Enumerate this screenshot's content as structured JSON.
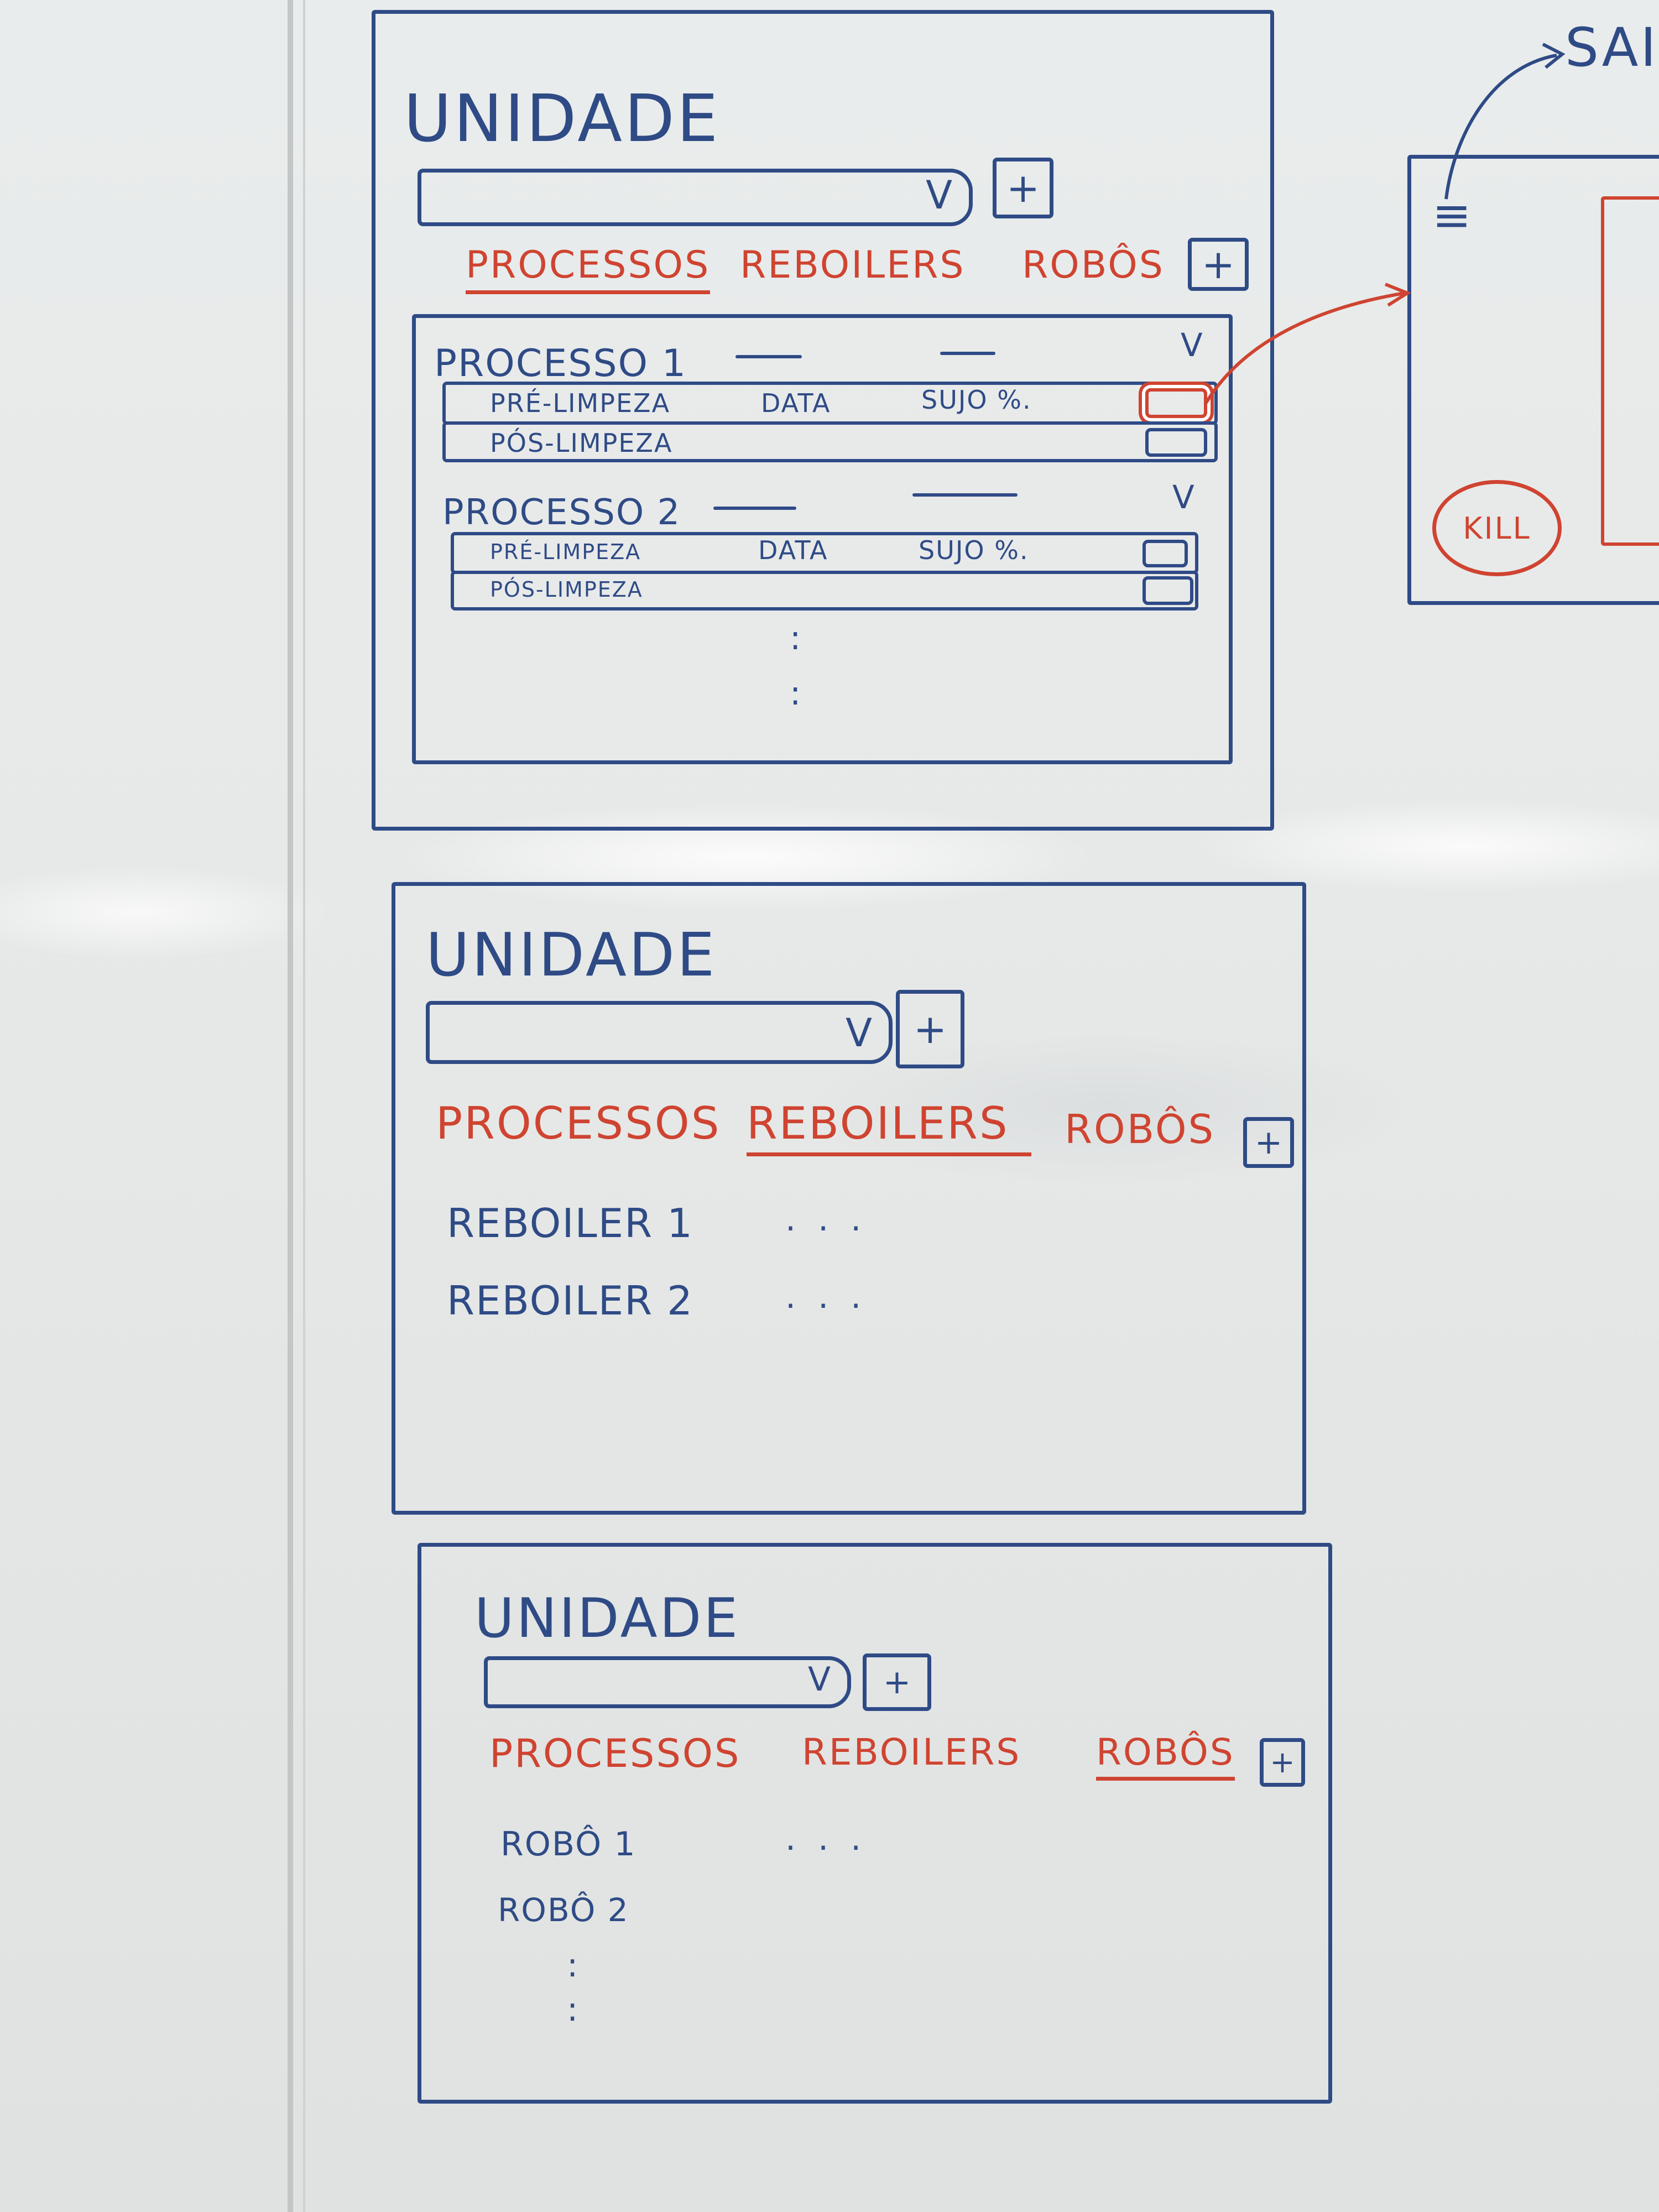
{
  "screen1": {
    "title": "UNIDADE",
    "dropdown_chevron": "V",
    "add_label": "+",
    "tabs": [
      "PROCESSOS",
      "REBOILERS",
      "ROBÔS"
    ],
    "active_tab": "PROCESSOS",
    "tab_add_label": "+",
    "processes": [
      {
        "name": "PROCESSO 1",
        "chevron": "V",
        "rows": [
          {
            "label": "PRÉ-LIMPEZA",
            "date": "DATA",
            "dirty": "SUJO %."
          },
          {
            "label": "PÓS-LIMPEZA",
            "date": "",
            "dirty": ""
          }
        ]
      },
      {
        "name": "PROCESSO 2",
        "chevron": "V",
        "rows": [
          {
            "label": "PRÉ-LIMPEZA",
            "date": "DATA",
            "dirty": "SUJO %."
          },
          {
            "label": "PÓS-LIMPEZA",
            "date": "",
            "dirty": ""
          }
        ]
      }
    ],
    "more": ":"
  },
  "side_panel": {
    "exit_label": "SAIR",
    "menu_icon": "≡",
    "kill_label": "KILL"
  },
  "screen2": {
    "title": "UNIDADE",
    "dropdown_chevron": "V",
    "add_label": "+",
    "tabs": [
      "PROCESSOS",
      "REBOILERS",
      "ROBÔS"
    ],
    "active_tab": "REBOILERS",
    "tab_add_label": "+",
    "items": [
      {
        "label": "REBOILER 1",
        "more": "..."
      },
      {
        "label": "REBOILER 2",
        "more": "..."
      }
    ]
  },
  "screen3": {
    "title": "UNIDADE",
    "dropdown_chevron": "V",
    "add_label": "+",
    "tabs": [
      "PROCESSOS",
      "REBOILERS",
      "ROBÔS"
    ],
    "active_tab": "ROBÔS",
    "tab_add_label": "+",
    "items": [
      {
        "label": "ROBÔ 1",
        "more": "..."
      },
      {
        "label": "ROBÔ 2",
        "more": ""
      }
    ],
    "more": ":"
  },
  "colors": {
    "ink_blue": "#2f4b86",
    "ink_red": "#cf4431",
    "board": "#eceeed"
  }
}
